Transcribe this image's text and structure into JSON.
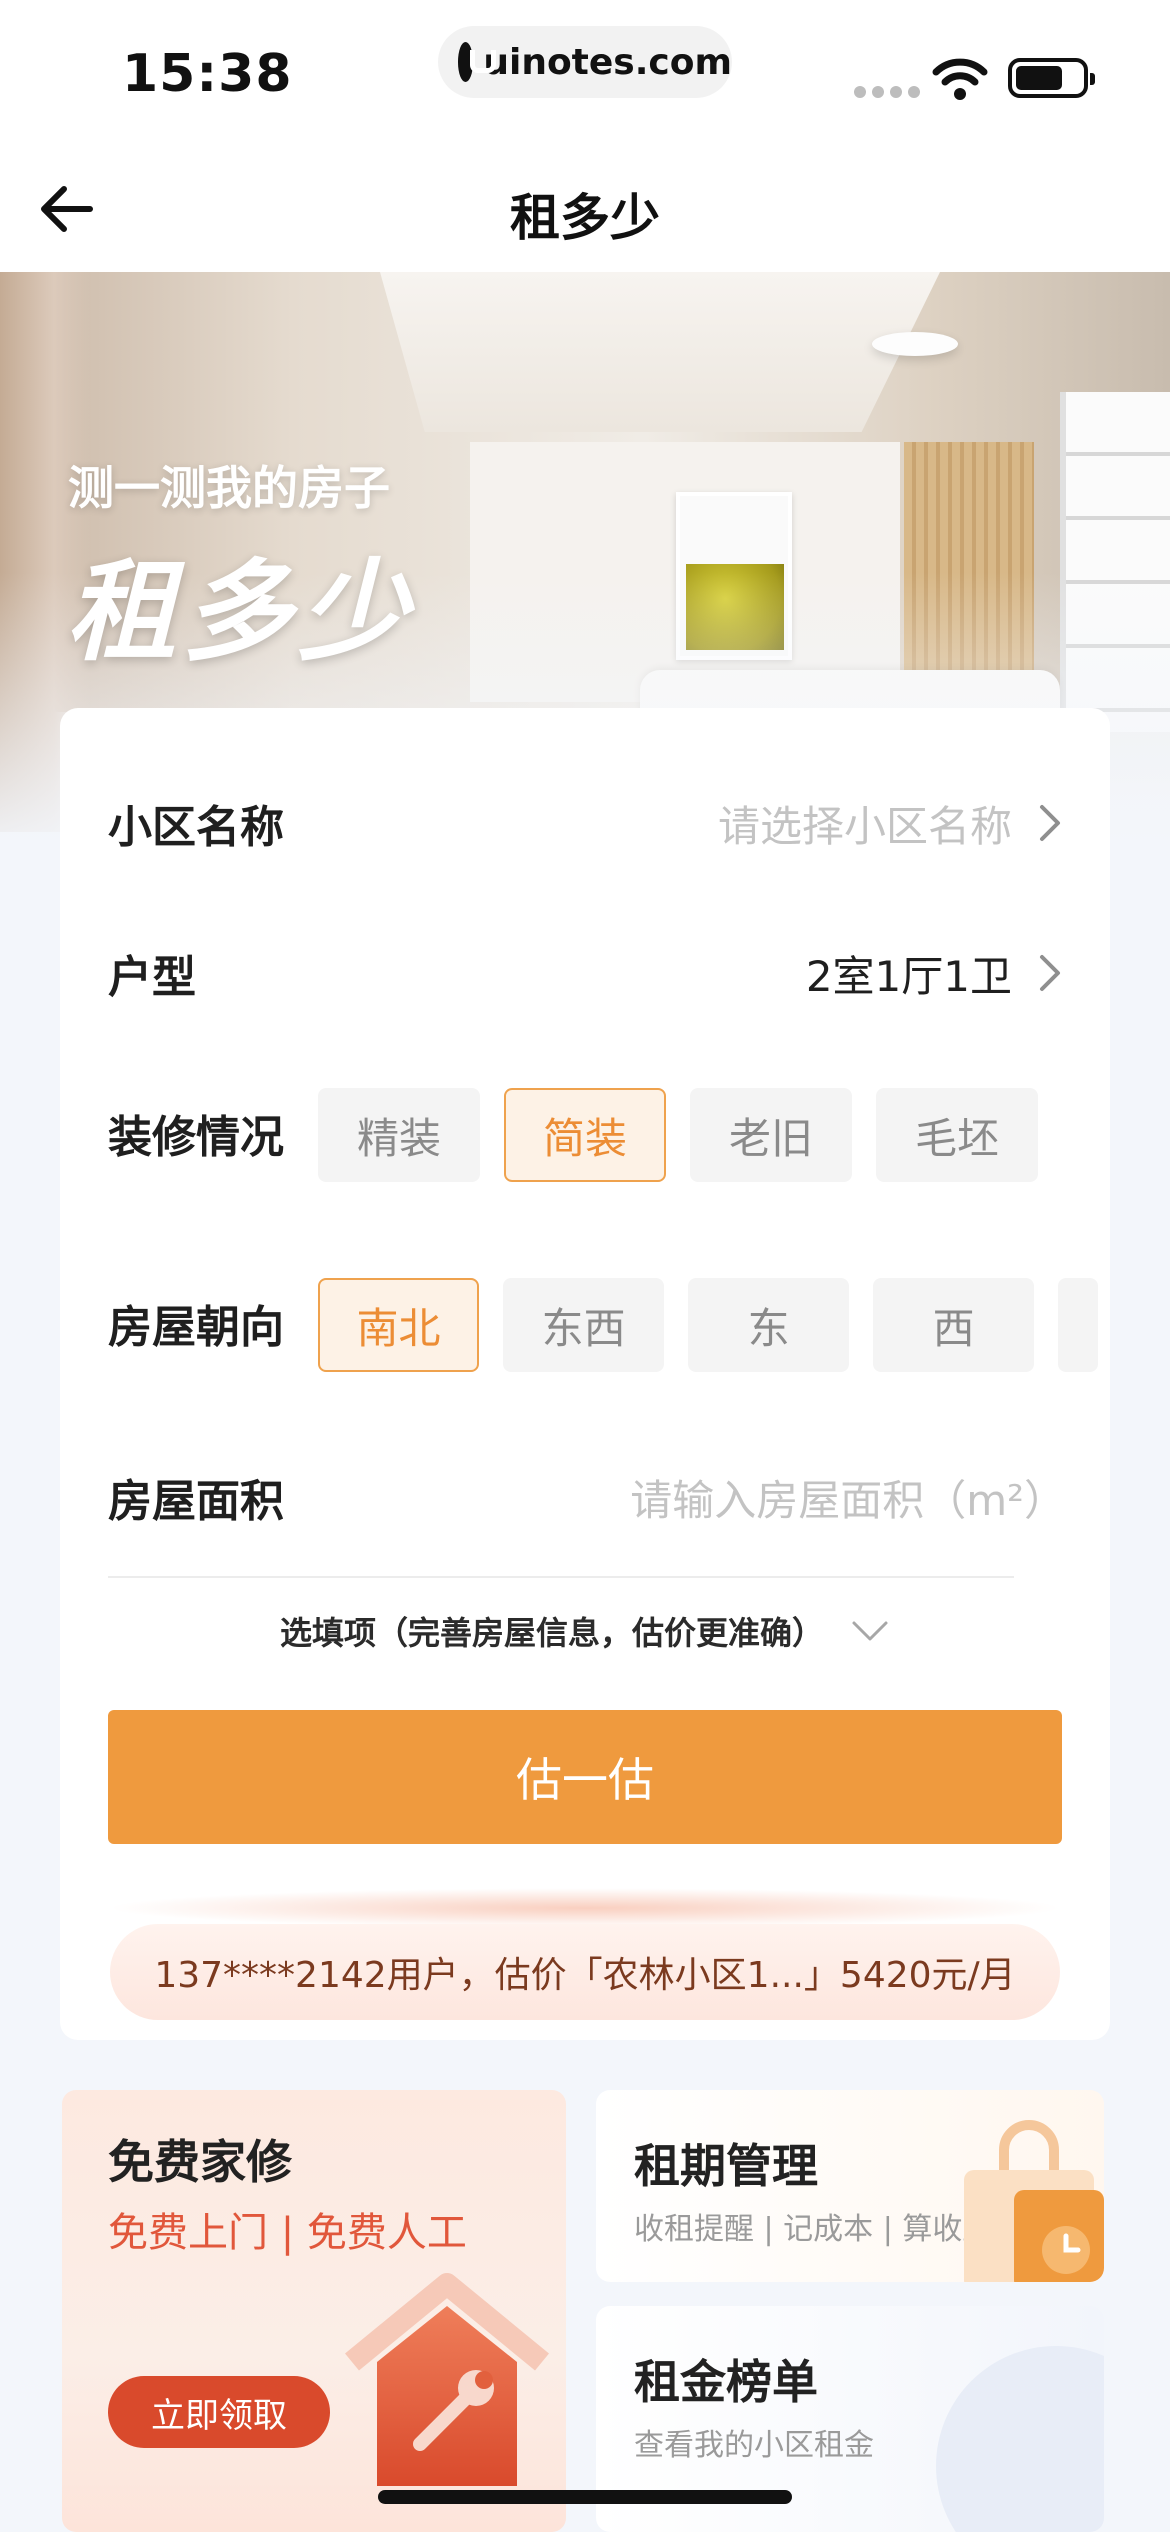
{
  "status_bar": {
    "time": "15:38",
    "url": "uinotes.com"
  },
  "nav": {
    "title": "租多少",
    "back_icon": "arrow-left-icon"
  },
  "hero": {
    "kicker": "测一测我的房子",
    "title": "租多少"
  },
  "form": {
    "community": {
      "label": "小区名称",
      "placeholder": "请选择小区名称"
    },
    "layout": {
      "label": "户型",
      "value": "2室1厅1卫"
    },
    "decoration": {
      "label": "装修情况",
      "options": [
        "精装",
        "简装",
        "老旧",
        "毛坯"
      ],
      "selected": "简装"
    },
    "orientation": {
      "label": "房屋朝向",
      "options": [
        "南北",
        "东西",
        "东",
        "西"
      ],
      "selected": "南北"
    },
    "area": {
      "label": "房屋面积",
      "placeholder": "请输入房屋面积（m²）"
    },
    "optional_toggle": "选填项（完善房屋信息，估价更准确）",
    "estimate_button": "估一估",
    "ticker": "137****2142用户，估价「农林小区1...」5420元/月"
  },
  "cards": {
    "repair": {
      "title": "免费家修",
      "subtitle": "免费上门 | 免费人工",
      "button": "立即领取"
    },
    "lease": {
      "title": "租期管理",
      "subtitle": "收租提醒 | 记成本 | 算收益"
    },
    "rank": {
      "title": "租金榜单",
      "subtitle": "查看我的小区租金"
    }
  },
  "colors": {
    "accent": "#ef9a3e",
    "selected_text": "#ec8d35",
    "repair_red": "#d94a2c"
  }
}
